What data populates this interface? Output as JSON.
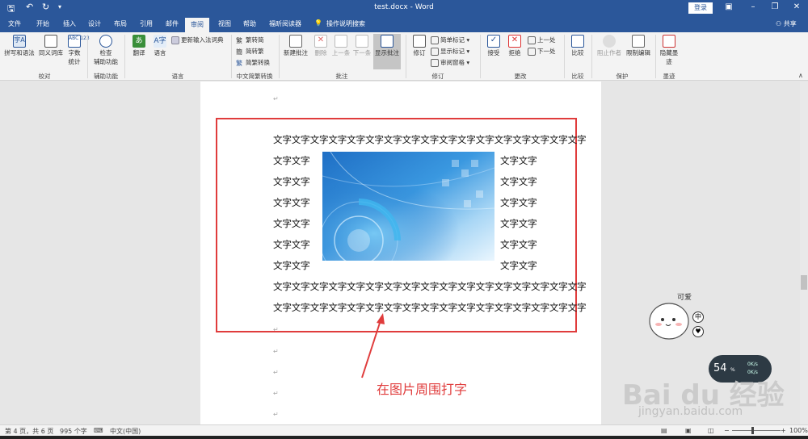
{
  "titlebar": {
    "title": "test.docx  -  Word",
    "login": "登录",
    "share": "共享"
  },
  "tabs": [
    "文件",
    "开始",
    "插入",
    "设计",
    "布局",
    "引用",
    "邮件",
    "审阅",
    "视图",
    "帮助",
    "福昕阅读器",
    "操作说明搜索"
  ],
  "active_tab": "审阅",
  "ribbon": {
    "proofing": {
      "spell": "拼写和语法",
      "thesaurus": "同义词库",
      "abc": "ABC\n123",
      "wordcount": "字数\n统计",
      "label": "校对"
    },
    "accessibility": {
      "check": "检查\n辅助功能",
      "label": "辅助功能"
    },
    "language": {
      "translate": "翻译",
      "language": "语言",
      "update_ime": "更新输入法词典",
      "label": "语言"
    },
    "chinese": {
      "to_simp": "繁转简",
      "to_trad": "简转繁",
      "convert": "简繁转换",
      "label": "中文简繁转换"
    },
    "comments": {
      "new": "新建批注",
      "delete": "删除",
      "prev": "上一条",
      "next": "下一条",
      "show": "显示批注",
      "label": "批注"
    },
    "tracking": {
      "track": "修订",
      "simple_markup": "简单标记",
      "show_markup": "显示标记",
      "review_pane": "审阅窗格",
      "label": "修订"
    },
    "changes": {
      "accept": "接受",
      "reject": "拒绝",
      "prev": "上一处",
      "next": "下一处",
      "label": "更改"
    },
    "compare": {
      "compare": "比较",
      "label": "比较"
    },
    "protect": {
      "block_authors": "阻止作者",
      "restrict": "限制编辑",
      "label": "保护"
    },
    "ink": {
      "hide_ink": "隐藏墨\n迹",
      "label": "墨迹"
    }
  },
  "document": {
    "full_line": "文字文字文字文字文字文字文字文字文字文字文字文字文字文字文字文字文字",
    "short": "文字文字",
    "annotation": "在图片周围打字"
  },
  "statusbar": {
    "page": "第 4 页，共 6 页",
    "words": "995 个字",
    "language": "中文(中国)",
    "zoom": "100%"
  },
  "overlay": {
    "mascot_label": "可爱",
    "badge1": "中",
    "badge2": "♥",
    "speed_pct": "54",
    "speed_up": "0K/s",
    "speed_down": "0K/s",
    "watermark": "Bai du 经验",
    "watermark_url": "jingyan.baidu.com"
  },
  "colors": {
    "brand": "#2b579a",
    "annotation": "#e03c3c"
  }
}
